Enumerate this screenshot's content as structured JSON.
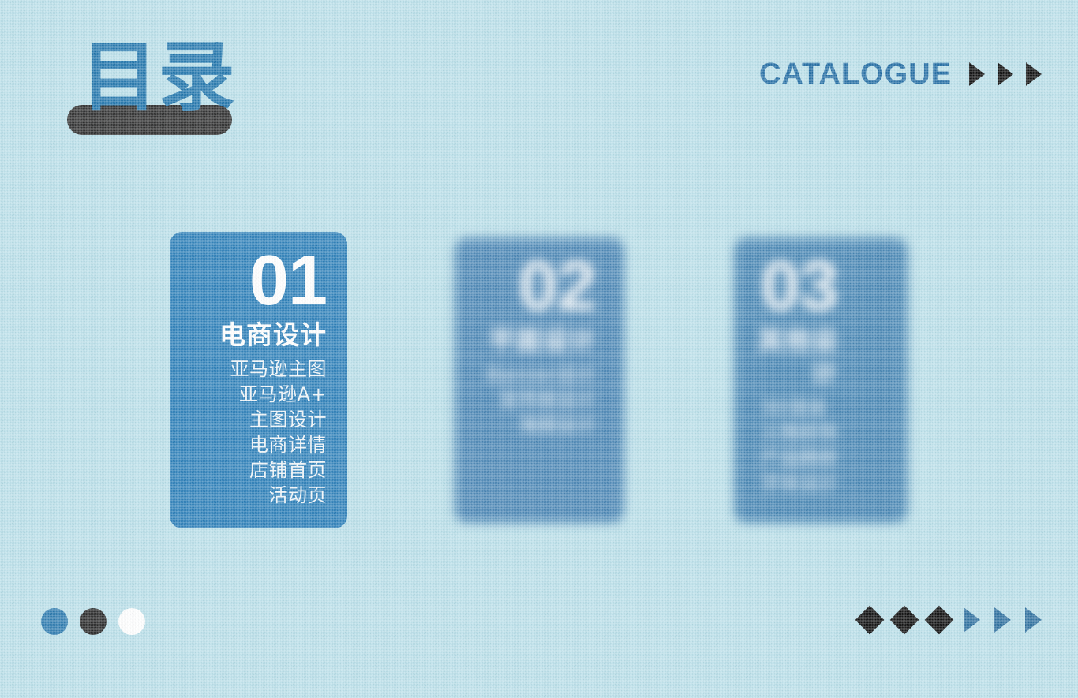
{
  "slide": {
    "background_color": "#b9dfe9",
    "accent_blue": "#2176ad",
    "card_blue": "#2b7fb9",
    "dark": "#2c2c2c"
  },
  "header": {
    "title": "目录",
    "catalogue_label": "CATALOGUE",
    "arrow_icons": [
      "triangle-right-icon",
      "triangle-right-icon",
      "triangle-right-icon"
    ]
  },
  "cards": [
    {
      "number": "01",
      "heading": "电商设计",
      "items": [
        "亚马逊主图",
        "亚马逊A+",
        "主图设计",
        "电商详情",
        "店铺首页",
        "活动页"
      ]
    },
    {
      "number": "02",
      "heading": "平面设计",
      "items": [
        "Banner设计",
        "宣传册设计",
        "海报设计"
      ]
    },
    {
      "number": "03",
      "heading": "其他设计",
      "items": [
        "3D渲染",
        "人物修饰",
        "产品精修",
        "字体设计"
      ]
    }
  ],
  "footer": {
    "dots": [
      {
        "name": "dot-blue",
        "color": "#2b7aaf"
      },
      {
        "name": "dot-dark",
        "color": "#262626"
      },
      {
        "name": "dot-white",
        "color": "#ffffff"
      }
    ],
    "shapes": [
      {
        "name": "diamond-icon",
        "color": "#0a0a0a"
      },
      {
        "name": "diamond-icon",
        "color": "#0a0a0a"
      },
      {
        "name": "diamond-icon",
        "color": "#0a0a0a"
      },
      {
        "name": "triangle-right-icon",
        "color": "#2b6e9e"
      },
      {
        "name": "triangle-right-icon",
        "color": "#2b6e9e"
      },
      {
        "name": "triangle-right-icon",
        "color": "#2b6e9e"
      }
    ]
  }
}
